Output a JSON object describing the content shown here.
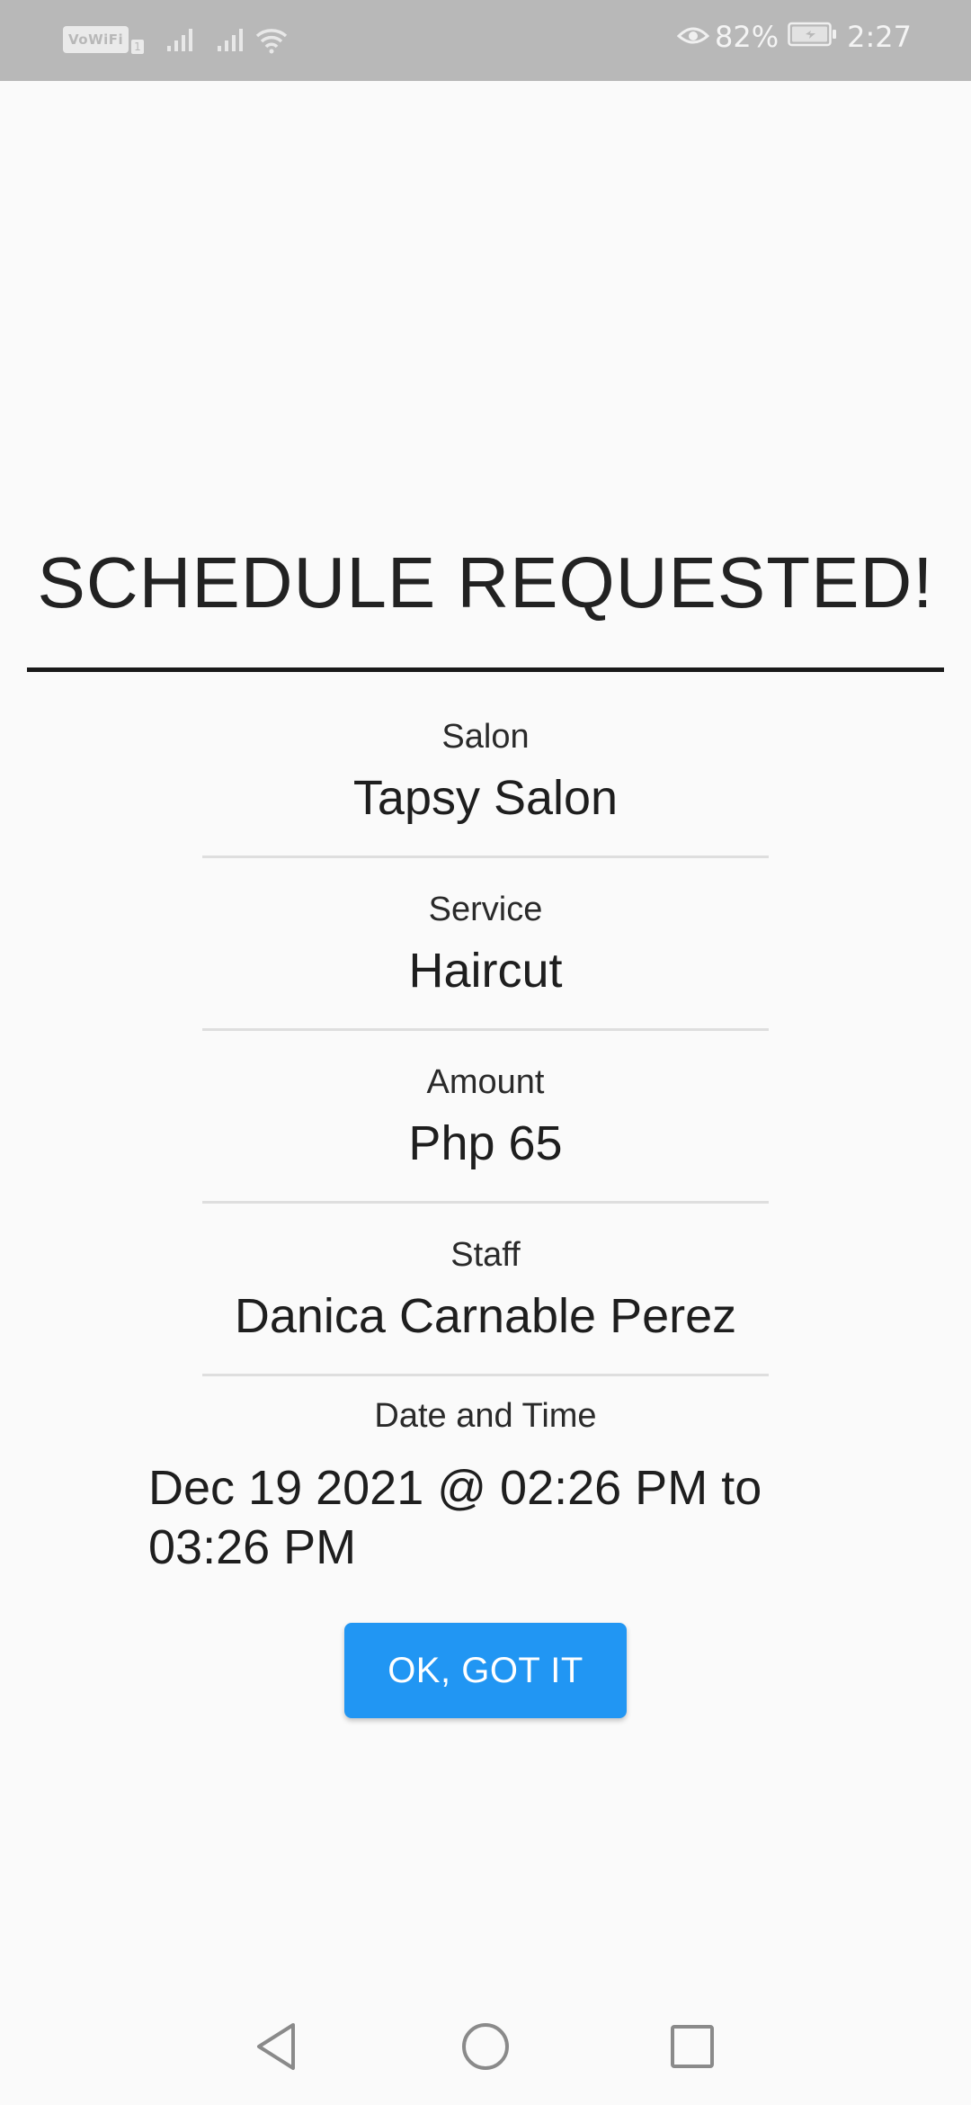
{
  "status_bar": {
    "vowifi_label": "VoWiFi",
    "vowifi_sub": "1",
    "battery_percent": "82%",
    "time": "2:27",
    "icons": [
      "vowifi-icon",
      "signal-icon",
      "signal-icon",
      "wifi-icon",
      "eye-comfort-icon",
      "battery-charging-icon"
    ]
  },
  "confirmation": {
    "title": "SCHEDULE REQUESTED!",
    "salon_label": "Salon",
    "salon_value": "Tapsy Salon",
    "service_label": "Service",
    "service_value": "Haircut",
    "amount_label": "Amount",
    "amount_value": "Php 65",
    "staff_label": "Staff",
    "staff_value": "Danica Carnable Perez",
    "datetime_label": "Date and Time",
    "datetime_value": "Dec 19 2021 @ 02:26 PM to 03:26 PM",
    "ok_button_label": "OK, GOT IT"
  },
  "nav_bar": {
    "icons": [
      "back-icon",
      "home-icon",
      "recents-icon"
    ]
  },
  "colors": {
    "status_bar": "#b8b8b8",
    "background": "#fafafa",
    "accent_button": "#2196f3",
    "title_rule": "#1a1a1a",
    "divider": "#dedede"
  }
}
